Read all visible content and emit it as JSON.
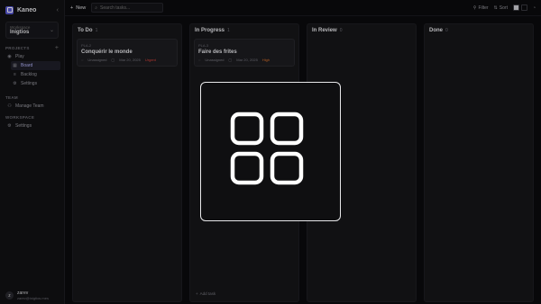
{
  "app": {
    "name": "Kaneo"
  },
  "workspace": {
    "label": "Workspace",
    "name": "Inigtios"
  },
  "sidebar": {
    "projects_title": "PROJECTS",
    "team_title": "TEAM",
    "workspace_title": "WORKSPACE",
    "project": {
      "label": "Play"
    },
    "project_items": [
      {
        "label": "Board",
        "icon": "board-icon",
        "active": true
      },
      {
        "label": "Backlog",
        "icon": "backlog-icon",
        "active": false
      },
      {
        "label": "Settings",
        "icon": "settings-icon",
        "active": false
      }
    ],
    "team_items": [
      {
        "label": "Manage Team",
        "icon": "users-icon"
      }
    ],
    "workspace_items": [
      {
        "label": "Settings",
        "icon": "gear-icon"
      }
    ]
  },
  "user": {
    "initial": "z",
    "name": "zarev",
    "email": "zarev@inigtios.mes"
  },
  "topbar": {
    "new_label": "New",
    "search_placeholder": "Search tasks...",
    "filter_label": "Filter",
    "sort_label": "Sort"
  },
  "columns": [
    {
      "title": "To Do",
      "count": "1",
      "cards": [
        {
          "id": "PLA-2",
          "title": "Conquérir le monde",
          "assignee": "Unassigned",
          "date": "Mar 20, 2025",
          "priority": "Urgent",
          "priority_color": "#e0443c"
        }
      ]
    },
    {
      "title": "In Progress",
      "count": "1",
      "add_task": "Add task",
      "cards": [
        {
          "id": "PLA-3",
          "title": "Faire des frites",
          "assignee": "Unassigned",
          "date": "Mar 20, 2025",
          "priority": "High",
          "priority_color": "#e0742c"
        }
      ]
    },
    {
      "title": "In Review",
      "count": "0",
      "cards": []
    },
    {
      "title": "Done",
      "count": "0",
      "cards": []
    }
  ],
  "modal": {
    "icon": "grid-four-icon",
    "border_color": "#e8e8ea"
  }
}
